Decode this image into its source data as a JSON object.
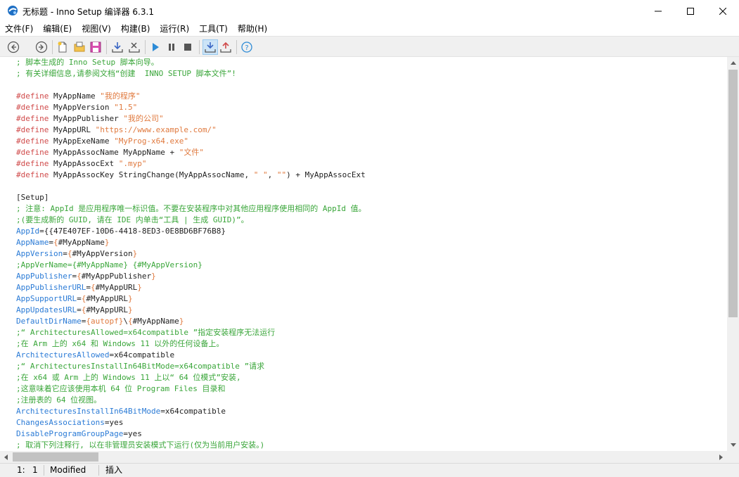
{
  "window": {
    "title": "无标题 - Inno Setup 编译器 6.3.1"
  },
  "menu": [
    "文件(F)",
    "编辑(E)",
    "视图(V)",
    "构建(B)",
    "运行(R)",
    "工具(T)",
    "帮助(H)"
  ],
  "toolbar": {
    "buttons": [
      {
        "name": "back-icon"
      },
      {
        "name": "forward-icon"
      },
      {
        "name": "new-file-icon"
      },
      {
        "name": "open-file-icon"
      },
      {
        "name": "save-icon"
      },
      {
        "name": "compile-icon"
      },
      {
        "name": "stop-compile-icon"
      },
      {
        "name": "run-icon"
      },
      {
        "name": "pause-icon"
      },
      {
        "name": "stop-icon"
      },
      {
        "name": "target-setup-icon",
        "active": true
      },
      {
        "name": "target-uninstall-icon"
      },
      {
        "name": "help-icon"
      }
    ]
  },
  "colors": {
    "comment": "#3aa63a",
    "preprocessor": "#d04a4a",
    "string": "#e07a3f",
    "key": "#2b7bd6",
    "text": "#222222"
  },
  "code_lines": [
    [
      [
        "comment",
        "; 脚本生成的 Inno Setup 脚本向导。"
      ]
    ],
    [
      [
        "comment",
        "; 有关详细信息,请参阅文档“创建  INNO SETUP 脚本文件”!"
      ]
    ],
    [],
    [
      [
        "pre",
        "#define"
      ],
      [
        "plain",
        " MyAppName "
      ],
      [
        "str",
        "\"我的程序\""
      ]
    ],
    [
      [
        "pre",
        "#define"
      ],
      [
        "plain",
        " MyAppVersion "
      ],
      [
        "str",
        "\"1.5\""
      ]
    ],
    [
      [
        "pre",
        "#define"
      ],
      [
        "plain",
        " MyAppPublisher "
      ],
      [
        "str",
        "\"我的公司\""
      ]
    ],
    [
      [
        "pre",
        "#define"
      ],
      [
        "plain",
        " MyAppURL "
      ],
      [
        "str",
        "\"https://www.example.com/\""
      ]
    ],
    [
      [
        "pre",
        "#define"
      ],
      [
        "plain",
        " MyAppExeName "
      ],
      [
        "str",
        "\"MyProg-x64.exe\""
      ]
    ],
    [
      [
        "pre",
        "#define"
      ],
      [
        "plain",
        " MyAppAssocName MyAppName + "
      ],
      [
        "str",
        "\"文件\""
      ]
    ],
    [
      [
        "pre",
        "#define"
      ],
      [
        "plain",
        " MyAppAssocExt "
      ],
      [
        "str",
        "\".myp\""
      ]
    ],
    [
      [
        "pre",
        "#define"
      ],
      [
        "plain",
        " MyAppAssocKey StringChange(MyAppAssocName, "
      ],
      [
        "str",
        "\" \""
      ],
      [
        "plain",
        ", "
      ],
      [
        "str",
        "\"\""
      ],
      [
        "plain",
        ") + MyAppAssocExt"
      ]
    ],
    [],
    [
      [
        "sec",
        "[Setup]"
      ]
    ],
    [
      [
        "comment",
        "; 注意: AppId 是应用程序唯一标识值。不要在安装程序中对其他应用程序使用相同的 AppId 值。"
      ]
    ],
    [
      [
        "comment",
        ";(要生成新的 GUID, 请在 IDE 内单击“工具 | 生成 GUID)”。"
      ]
    ],
    [
      [
        "key",
        "AppId"
      ],
      [
        "plain",
        "={{47E407EF-10D6-4418-8ED3-0E8BD6BF76B8}"
      ]
    ],
    [
      [
        "key",
        "AppName"
      ],
      [
        "plain",
        "="
      ],
      [
        "str",
        "{"
      ],
      [
        "plain",
        "#MyAppName"
      ],
      [
        "str",
        "}"
      ]
    ],
    [
      [
        "key",
        "AppVersion"
      ],
      [
        "plain",
        "="
      ],
      [
        "str",
        "{"
      ],
      [
        "plain",
        "#MyAppVersion"
      ],
      [
        "str",
        "}"
      ]
    ],
    [
      [
        "comment",
        ";AppVerName={#MyAppName} {#MyAppVersion}"
      ]
    ],
    [
      [
        "key",
        "AppPublisher"
      ],
      [
        "plain",
        "="
      ],
      [
        "str",
        "{"
      ],
      [
        "plain",
        "#MyAppPublisher"
      ],
      [
        "str",
        "}"
      ]
    ],
    [
      [
        "key",
        "AppPublisherURL"
      ],
      [
        "plain",
        "="
      ],
      [
        "str",
        "{"
      ],
      [
        "plain",
        "#MyAppURL"
      ],
      [
        "str",
        "}"
      ]
    ],
    [
      [
        "key",
        "AppSupportURL"
      ],
      [
        "plain",
        "="
      ],
      [
        "str",
        "{"
      ],
      [
        "plain",
        "#MyAppURL"
      ],
      [
        "str",
        "}"
      ]
    ],
    [
      [
        "key",
        "AppUpdatesURL"
      ],
      [
        "plain",
        "="
      ],
      [
        "str",
        "{"
      ],
      [
        "plain",
        "#MyAppURL"
      ],
      [
        "str",
        "}"
      ]
    ],
    [
      [
        "key",
        "DefaultDirName"
      ],
      [
        "plain",
        "="
      ],
      [
        "str",
        "{autopf}"
      ],
      [
        "plain",
        "\\"
      ],
      [
        "str",
        "{"
      ],
      [
        "plain",
        "#MyAppName"
      ],
      [
        "str",
        "}"
      ]
    ],
    [
      [
        "comment",
        ";“ ArchitecturesAllowed=x64compatible ”指定安装程序无法运行"
      ]
    ],
    [
      [
        "comment",
        ";在 Arm 上的 x64 和 Windows 11 以外的任何设备上。"
      ]
    ],
    [
      [
        "key",
        "ArchitecturesAllowed"
      ],
      [
        "plain",
        "=x64compatible"
      ]
    ],
    [
      [
        "comment",
        ";“ ArchitecturesInstallIn64BitMode=x64compatible ”请求"
      ]
    ],
    [
      [
        "comment",
        ";在 x64 或 Arm 上的 Windows 11 上以“ 64 位模式”安装,"
      ]
    ],
    [
      [
        "comment",
        ";这意味着它应该使用本机 64 位 Program Files 目录和"
      ]
    ],
    [
      [
        "comment",
        ";注册表的 64 位视图。"
      ]
    ],
    [
      [
        "key",
        "ArchitecturesInstallIn64BitMode"
      ],
      [
        "plain",
        "=x64compatible"
      ]
    ],
    [
      [
        "key",
        "ChangesAssociations"
      ],
      [
        "plain",
        "=yes"
      ]
    ],
    [
      [
        "key",
        "DisableProgramGroupPage"
      ],
      [
        "plain",
        "=yes"
      ]
    ],
    [
      [
        "comment",
        "; 取消下列注释行, 以在非管理员安装模式下运行(仅为当前用户安装。)"
      ]
    ]
  ],
  "status": {
    "line": "1:",
    "col": "1",
    "modified": "Modified",
    "mode": "插入"
  }
}
